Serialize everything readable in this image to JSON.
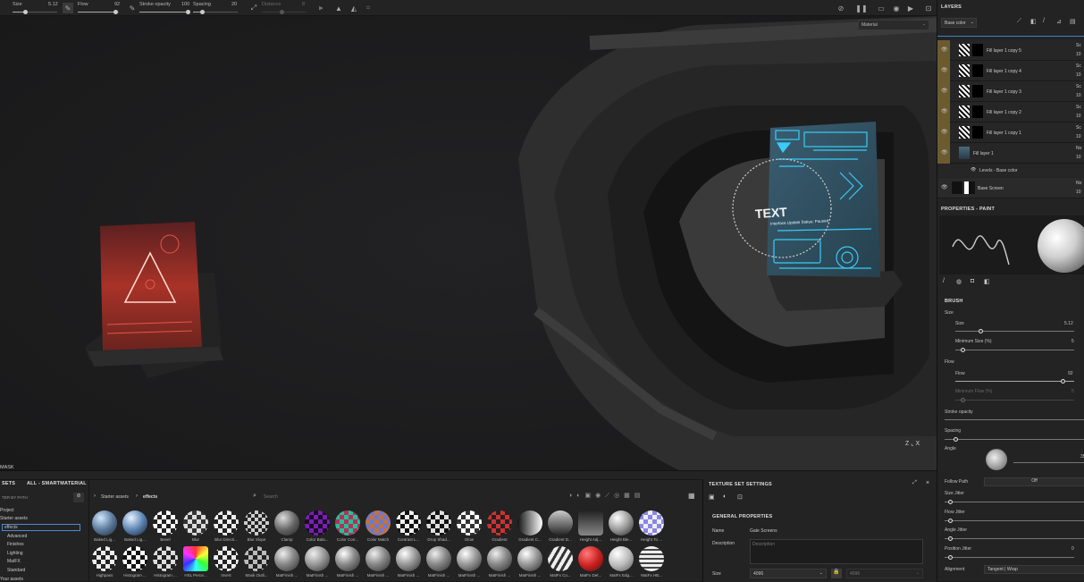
{
  "toolbar": {
    "size_label": "Size",
    "size_value": "5.12",
    "flow_label": "Flow",
    "flow_value": "92",
    "opacity_label": "Stroke opacity",
    "opacity_value": "100",
    "spacing_label": "Spacing",
    "spacing_value": "20",
    "distance_label": "Distance",
    "distance_value": "8"
  },
  "viewport": {
    "display_mode": "Material",
    "text_decal": "TEXT",
    "text_decal_sub": "Interface Update Status: Paused",
    "colors": {
      "red_screen": "#c3312b",
      "cyan_screen": "#3ad3ff"
    }
  },
  "layers": {
    "title": "LAYERS",
    "channel": "Base color",
    "items": [
      {
        "name": "Fill layer 1 copy 5",
        "blend": "Sc",
        "opacity": "10"
      },
      {
        "name": "Fill layer 1 copy 4",
        "blend": "Sc",
        "opacity": "10"
      },
      {
        "name": "Fill layer 1 copy 3",
        "blend": "Sc",
        "opacity": "10"
      },
      {
        "name": "Fill layer 1 copy 2",
        "blend": "Sc",
        "opacity": "10"
      },
      {
        "name": "Fill layer 1 copy 1",
        "blend": "Sc",
        "opacity": "10"
      },
      {
        "name": "Fill layer 1",
        "blend": "No",
        "opacity": "10"
      }
    ],
    "filter": "Levels - Base color",
    "base": {
      "name": "Base Screen",
      "blend": "No",
      "opacity": "10"
    }
  },
  "properties": {
    "title": "PROPERTIES - PAINT",
    "brush": "BRUSH",
    "size": "Size",
    "size_sub": "Size",
    "size_val": "5.12",
    "min_size": "Minimum Size (%)",
    "min_size_val": "5",
    "flow": "Flow",
    "flow_sub": "Flow",
    "flow_val": "92",
    "min_flow": "Minimum Flow (%)",
    "min_flow_val": "5",
    "stroke_opacity": "Stroke opacity",
    "spacing": "Spacing",
    "angle": "Angle",
    "angle_val": "35",
    "follow_path": "Follow Path",
    "follow_path_val": "Off",
    "size_jitter": "Size Jitter",
    "flow_jitter": "Flow Jitter",
    "angle_jitter": "Angle Jitter",
    "position_jitter": "Position Jitter",
    "position_jitter_val": "0",
    "alignment": "Alignment",
    "alignment_val": "Tangent | Wrap"
  },
  "assets": {
    "mask_label": "MASK",
    "tab1": "SETS",
    "tab2": "ALL - SMARTMATERIAL",
    "filter_label": "TER BY PATH",
    "tree": [
      "Project",
      "Starter assets",
      "effects",
      "Advanced",
      "Finishes",
      "Lighting",
      "MatFX",
      "Standard",
      "Your assets"
    ],
    "breadcrumb1": "Starter assets",
    "breadcrumb2": "effects",
    "search_placeholder": "Search",
    "row1": [
      "Baked Lig...",
      "Baked Lig...",
      "Bevel",
      "Blur",
      "Blur Directi...",
      "Blur Slope",
      "Clamp",
      "Color Bala...",
      "Color Corr...",
      "Color Match",
      "Contrast L...",
      "Drop Shad...",
      "Glow",
      "Gradient",
      "Gradient C...",
      "Gradient D...",
      "Height Adj...",
      "Height Ble...",
      "Height To ..."
    ],
    "row2": [
      "Highpass",
      "Histogram ...",
      "Histogram ...",
      "HSL Perce...",
      "Invert",
      "Mask Outli...",
      "MatFinish ...",
      "MatFinish ...",
      "MatFinish ...",
      "MatFinish ...",
      "MatFinish ...",
      "MatFinish ...",
      "MatFinish ...",
      "MatFinish ...",
      "MatFinish ...",
      "MatFx Co...",
      "MatFx Det...",
      "MatFx Edg...",
      "MatFx HB..."
    ]
  },
  "texture_set": {
    "title": "TEXTURE SET SETTINGS",
    "general": "GENERAL PROPERTIES",
    "name_label": "Name",
    "name_value": "Gate Screens",
    "desc_label": "Description",
    "desc_placeholder": "Description",
    "size_label": "Size",
    "size_value": "4096",
    "size_value2": "4096"
  }
}
